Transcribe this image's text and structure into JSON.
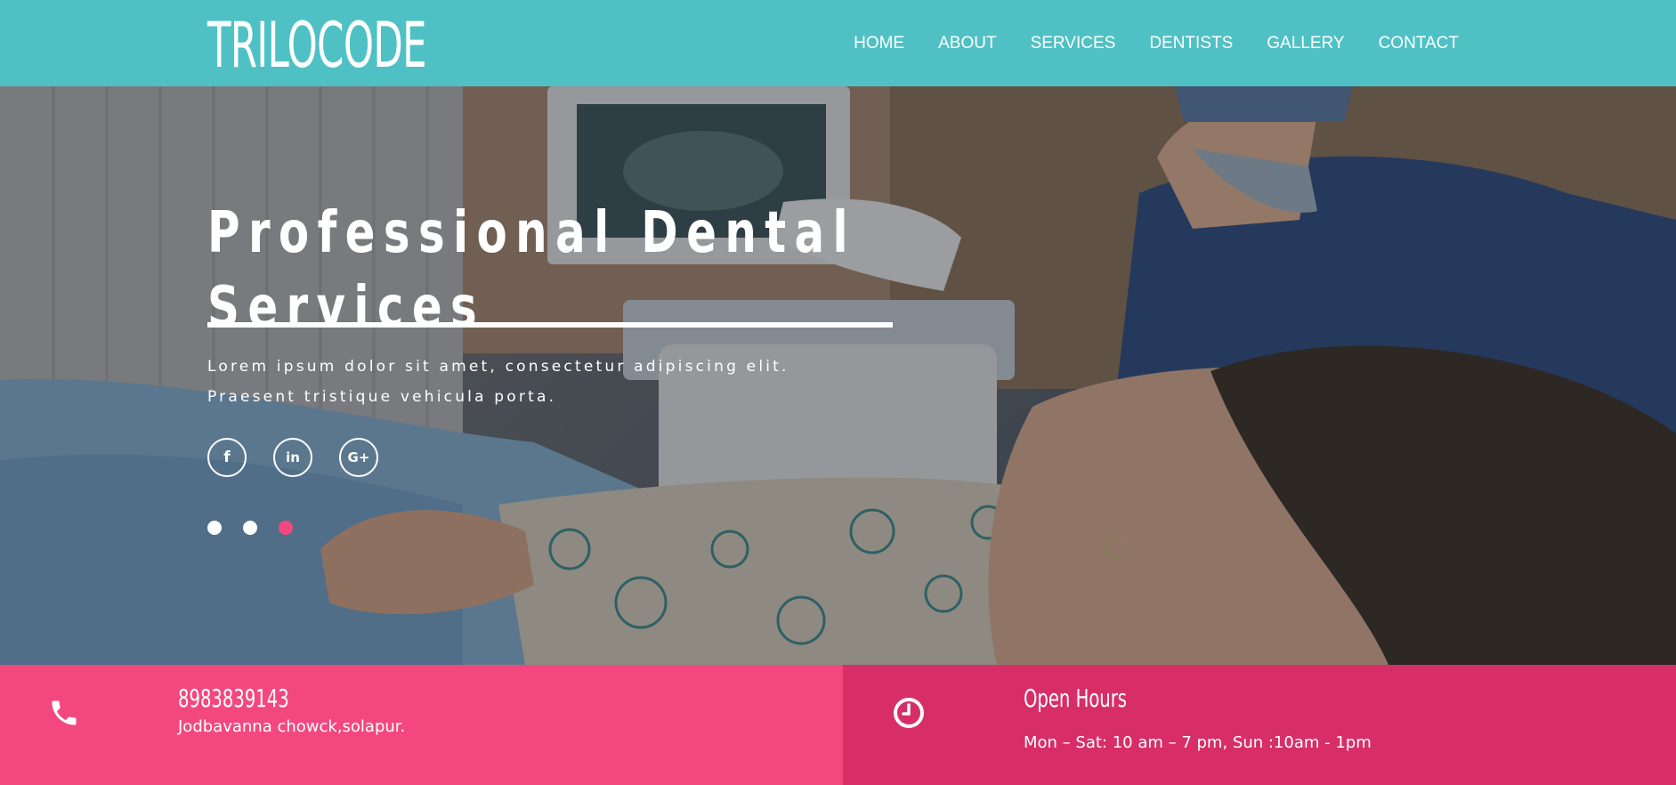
{
  "brand": {
    "name": "TRILOCODE"
  },
  "nav": {
    "items": [
      {
        "label": "HOME"
      },
      {
        "label": "ABOUT"
      },
      {
        "label": "SERVICES"
      },
      {
        "label": "DENTISTS"
      },
      {
        "label": "GALLERY"
      },
      {
        "label": "CONTACT"
      }
    ]
  },
  "hero": {
    "title_line1": "Professional Dental",
    "title_line2": "Services",
    "text_line1": "Lorem ipsum dolor sit amet, consectetur adipiscing elit.",
    "text_line2": "Praesent tristique vehicula porta.",
    "socials": [
      {
        "icon": "facebook-icon",
        "glyph": "f"
      },
      {
        "icon": "linkedin-icon",
        "glyph": "in"
      },
      {
        "icon": "google-plus-icon",
        "glyph": "G+"
      }
    ],
    "slider": {
      "count": 3,
      "active_index": 2
    }
  },
  "contact": {
    "phone": "8983839143",
    "address": "Jodbavanna chowck,solapur.",
    "icon": "phone-icon"
  },
  "hours": {
    "title": "Open Hours",
    "text": "Mon – Sat: 10 am – 7 pm, Sun :10am - 1pm",
    "icon": "clock-icon"
  },
  "colors": {
    "header": "#4fc1c5",
    "accent_pink": "#f3487f",
    "accent_dark_pink": "#d72e68",
    "slider_active": "#f3477f"
  }
}
